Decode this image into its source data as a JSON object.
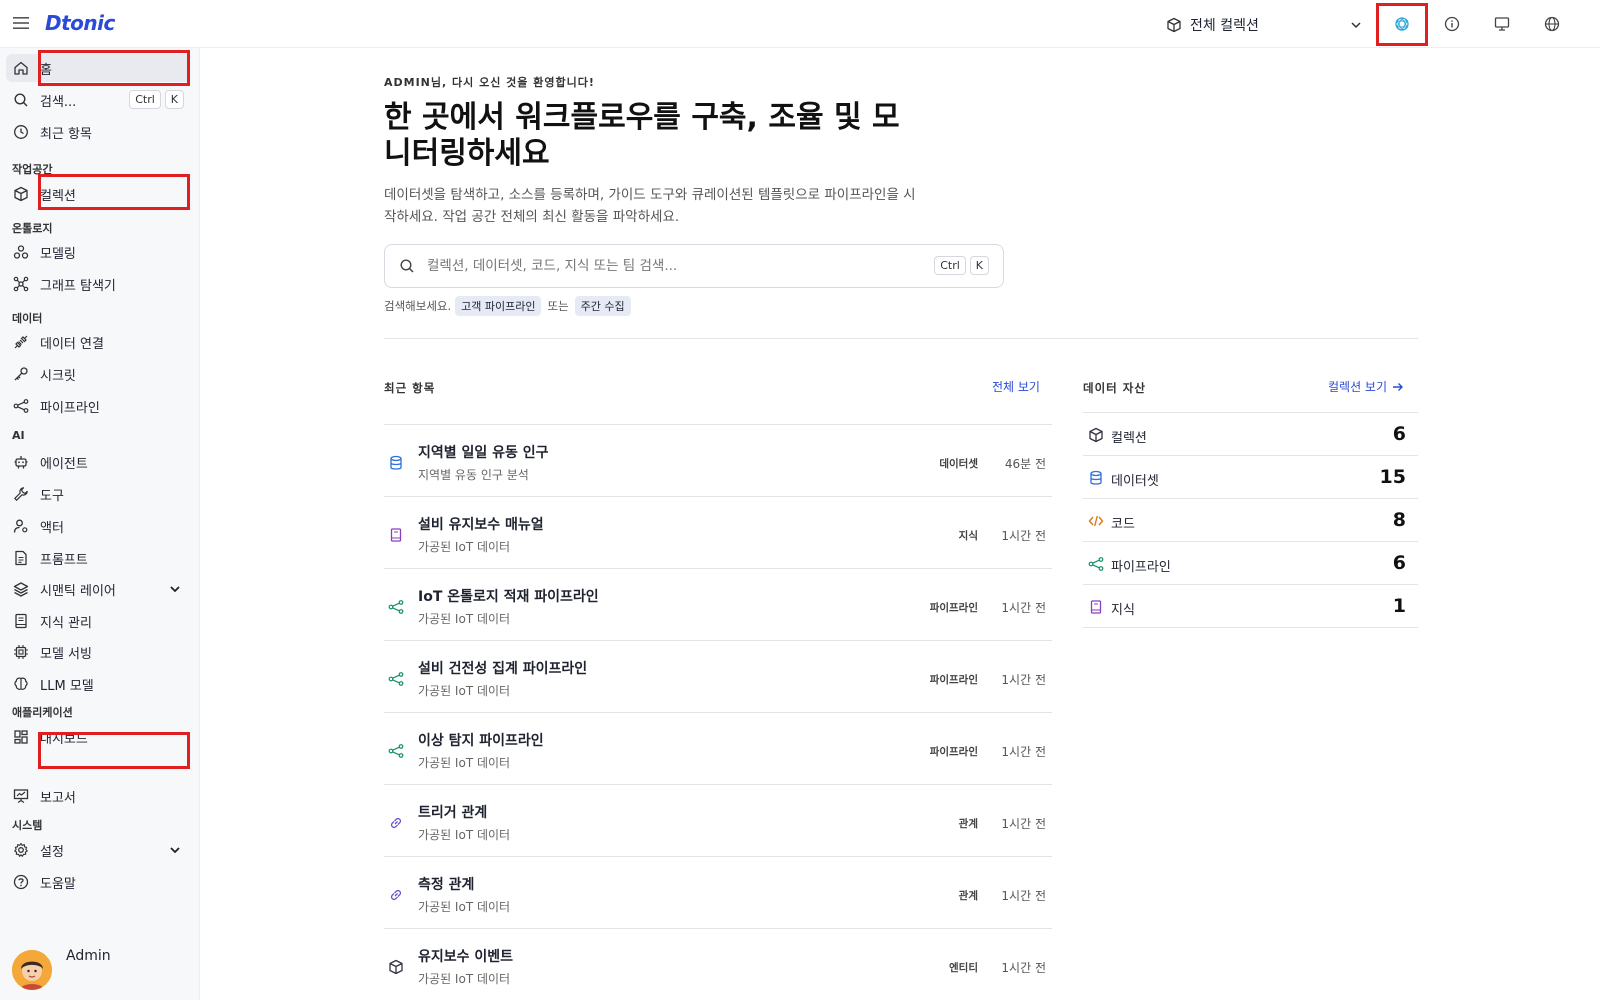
{
  "app": {
    "logo": "Dtonic"
  },
  "header": {
    "collection_label": "전체 컬렉션"
  },
  "sidebar": {
    "home": "홈",
    "search": "검색...",
    "search_kbd": [
      "Ctrl",
      "K"
    ],
    "recent": "최근 항목",
    "sections": {
      "workspace": "작업공간",
      "ontology": "온톨로지",
      "data": "데이터",
      "ai": "AI",
      "apps": "애플리케이션",
      "system": "시스템"
    },
    "collection": "컬렉션",
    "modeling": "모델링",
    "graph_explorer": "그래프 탐색기",
    "data_connection": "데이터 연결",
    "secrets": "시크릿",
    "pipeline": "파이프라인",
    "agent": "에이전트",
    "tools": "도구",
    "actor": "액터",
    "prompt": "프롬프트",
    "semantic_layer": "시맨틱 레이어",
    "knowledge": "지식 관리",
    "model_serving": "모델 서빙",
    "llm_model": "LLM 모델",
    "dashboard": "대시보드",
    "report": "보고서",
    "settings": "설정",
    "help": "도움말",
    "user_name": "Admin"
  },
  "main": {
    "welcome": "ADMIN님, 다시 오신 것을 환영합니다!",
    "hero": "한 곳에서 워크플로우를 구축, 조율 및 모니터링하세요",
    "description": "데이터셋을 탐색하고, 소스를 등록하며, 가이드 도구와 큐레이션된 템플릿으로 파이프라인을 시작하세요. 작업 공간 전체의 최신 활동을 파악하세요.",
    "search_placeholder": "컬렉션, 데이터셋, 코드, 지식 또는 팀 검색...",
    "search_kbd": [
      "Ctrl",
      "K"
    ],
    "try_prefix": "검색해보세요.",
    "try_chip1": "고객 파이프라인",
    "try_or": "또는",
    "try_chip2": "주간 수집",
    "recent": {
      "title": "최근 항목",
      "view_all": "전체 보기",
      "items": [
        {
          "title": "지역별 일일 유동 인구",
          "sub": "지역별 유동 인구 분석",
          "type": "데이터셋",
          "time": "46분 전",
          "icon": "database-icon"
        },
        {
          "title": "설비 유지보수 매뉴얼",
          "sub": "가공된 IoT 데이터",
          "type": "지식",
          "time": "1시간 전",
          "icon": "book-icon"
        },
        {
          "title": "IoT 온톨로지 적재 파이프라인",
          "sub": "가공된 IoT 데이터",
          "type": "파이프라인",
          "time": "1시간 전",
          "icon": "pipeline-icon"
        },
        {
          "title": "설비 건전성 집계 파이프라인",
          "sub": "가공된 IoT 데이터",
          "type": "파이프라인",
          "time": "1시간 전",
          "icon": "pipeline-icon"
        },
        {
          "title": "이상 탐지 파이프라인",
          "sub": "가공된 IoT 데이터",
          "type": "파이프라인",
          "time": "1시간 전",
          "icon": "pipeline-icon"
        },
        {
          "title": "트리거 관계",
          "sub": "가공된 IoT 데이터",
          "type": "관계",
          "time": "1시간 전",
          "icon": "link-icon"
        },
        {
          "title": "측정 관계",
          "sub": "가공된 IoT 데이터",
          "type": "관계",
          "time": "1시간 전",
          "icon": "link-icon"
        },
        {
          "title": "유지보수 이벤트",
          "sub": "가공된 IoT 데이터",
          "type": "엔티티",
          "time": "1시간 전",
          "icon": "cube-icon"
        }
      ]
    },
    "assets": {
      "title": "데이터 자산",
      "link": "컬렉션 보기",
      "items": [
        {
          "name": "컬렉션",
          "count": "6",
          "icon": "cube-icon"
        },
        {
          "name": "데이터셋",
          "count": "15",
          "icon": "database-icon"
        },
        {
          "name": "코드",
          "count": "8",
          "icon": "code-icon"
        },
        {
          "name": "파이프라인",
          "count": "6",
          "icon": "pipeline-icon"
        },
        {
          "name": "지식",
          "count": "1",
          "icon": "book-icon"
        }
      ]
    }
  },
  "colors": {
    "accent": "#2a4bd7",
    "highlight": "#e02020",
    "dataset_icon": "#2e6fd9",
    "knowledge_icon": "#8a3fc0",
    "pipeline_icon": "#15906b",
    "relation_icon": "#6a4fd0",
    "code_icon": "#d97a16"
  }
}
